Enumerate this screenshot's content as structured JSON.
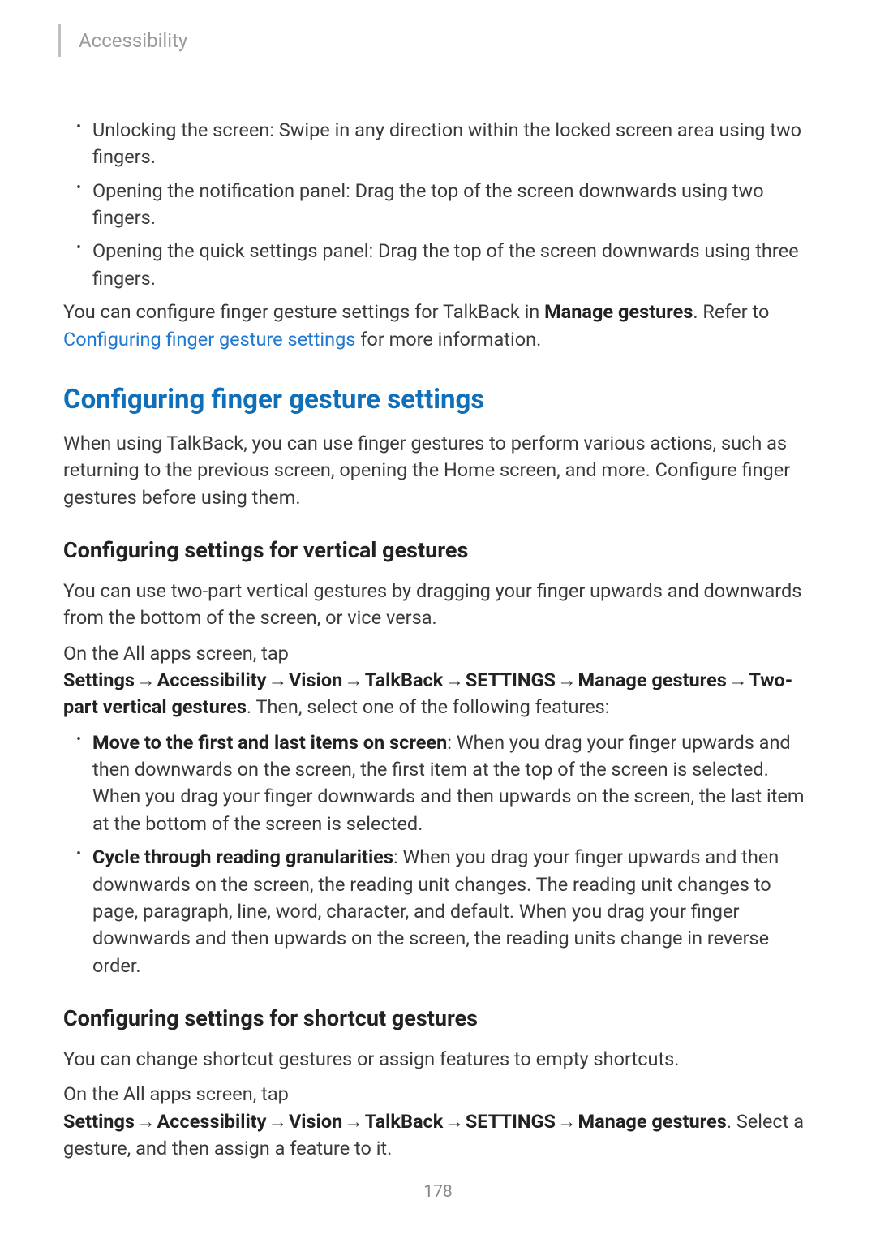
{
  "header": {
    "category": "Accessibility"
  },
  "bullets_top": [
    "Unlocking the screen: Swipe in any direction within the locked screen area using two fingers.",
    "Opening the notification panel: Drag the top of the screen downwards using two fingers.",
    "Opening the quick settings panel: Drag the top of the screen downwards using three fingers."
  ],
  "para_config_intro_pre": "You can configure finger gesture settings for TalkBack in ",
  "para_config_intro_bold": "Manage gestures",
  "para_config_intro_mid": ". Refer to ",
  "para_config_intro_link": "Configuring finger gesture settings",
  "para_config_intro_post": " for more information.",
  "section_heading": "Configuring finger gesture settings",
  "section_para": "When using TalkBack, you can use finger gestures to perform various actions, such as returning to the previous screen, opening the Home screen, and more. Configure finger gestures before using them.",
  "vertical": {
    "heading": "Configuring settings for vertical gestures",
    "para1": "You can use two-part vertical gestures by dragging your finger upwards and downwards from the bottom of the screen, or vice versa.",
    "path_pre": "On the All apps screen, tap ",
    "path_parts": [
      "Settings",
      "Accessibility",
      "Vision",
      "TalkBack",
      "SETTINGS",
      "Manage gestures",
      "Two-part vertical gestures"
    ],
    "path_post": ". Then, select one of the following features:",
    "bullets": [
      {
        "bold": "Move to the first and last items on screen",
        "rest": ": When you drag your finger upwards and then downwards on the screen, the first item at the top of the screen is selected. When you drag your finger downwards and then upwards on the screen, the last item at the bottom of the screen is selected."
      },
      {
        "bold": "Cycle through reading granularities",
        "rest": ": When you drag your finger upwards and then downwards on the screen, the reading unit changes. The reading unit changes to page, paragraph, line, word, character, and default. When you drag your finger downwards and then upwards on the screen, the reading units change in reverse order."
      }
    ]
  },
  "shortcut": {
    "heading": "Configuring settings for shortcut gestures",
    "para1": "You can change shortcut gestures or assign features to empty shortcuts.",
    "path_pre": "On the All apps screen, tap ",
    "path_parts": [
      "Settings",
      "Accessibility",
      "Vision",
      "TalkBack",
      "SETTINGS",
      "Manage gestures"
    ],
    "path_post": ". Select a gesture, and then assign a feature to it."
  },
  "arrow_glyph": "→",
  "page_number": "178"
}
